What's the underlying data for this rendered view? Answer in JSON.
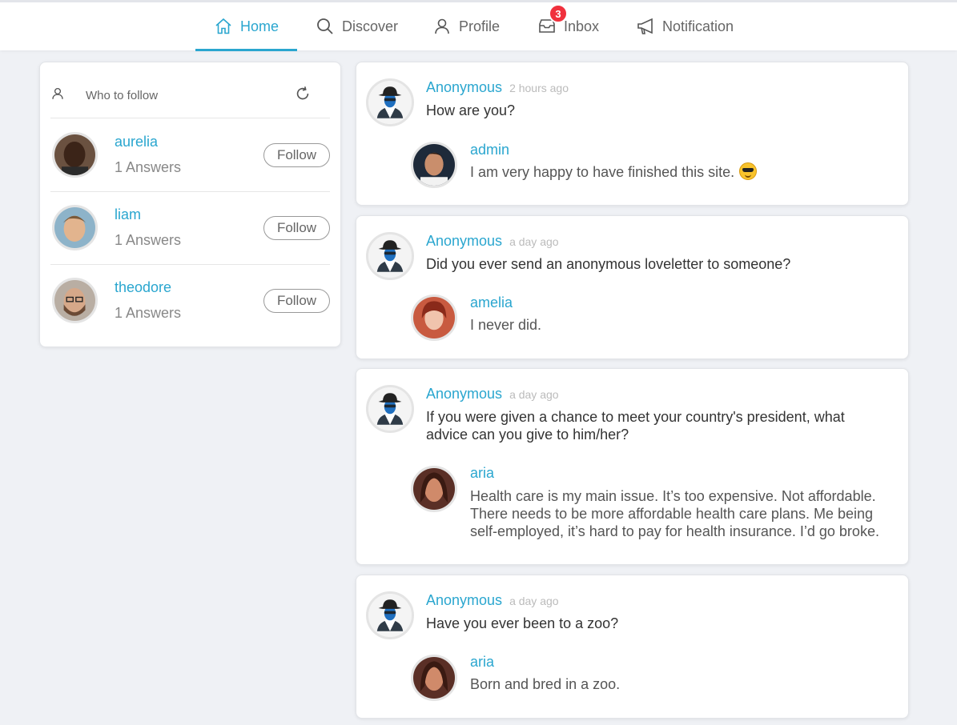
{
  "nav": {
    "items": [
      {
        "label": "Home",
        "icon": "home-icon",
        "active": true
      },
      {
        "label": "Discover",
        "icon": "search-icon"
      },
      {
        "label": "Profile",
        "icon": "user-icon"
      },
      {
        "label": "Inbox",
        "icon": "inbox-icon",
        "badge": "3"
      },
      {
        "label": "Notification",
        "icon": "megaphone-icon"
      }
    ],
    "accent_color": "#2aa6cf",
    "badge_color": "#f0303d"
  },
  "who_to_follow": {
    "title": "Who to follow",
    "users": [
      {
        "name": "aurelia",
        "answers": "1 Answers",
        "button": "Follow"
      },
      {
        "name": "liam",
        "answers": "1 Answers",
        "button": "Follow"
      },
      {
        "name": "theodore",
        "answers": "1 Answers",
        "button": "Follow"
      }
    ]
  },
  "feed": [
    {
      "asker": "Anonymous",
      "time": "2 hours ago",
      "question": "How are you?",
      "answerer": "admin",
      "answer": "I am very happy to have finished this site.",
      "answer_emoji": "sunglasses-emoji"
    },
    {
      "asker": "Anonymous",
      "time": "a day ago",
      "question": "Did you ever send an anonymous loveletter to someone?",
      "answerer": "amelia",
      "answer": "I never did."
    },
    {
      "asker": "Anonymous",
      "time": "a day ago",
      "question": "If you were given a chance to meet your country's president, what advice can you give to him/her?",
      "answerer": "aria",
      "answer": "Health care is my main issue. It’s too expensive. Not affordable. There needs to be more affordable health care plans. Me being self-employed, it’s hard to pay for health insurance. I’d go broke."
    },
    {
      "asker": "Anonymous",
      "time": "a day ago",
      "question": "Have you ever been to a zoo?",
      "answerer": "aria",
      "answer": "Born and bred in a zoo."
    }
  ]
}
